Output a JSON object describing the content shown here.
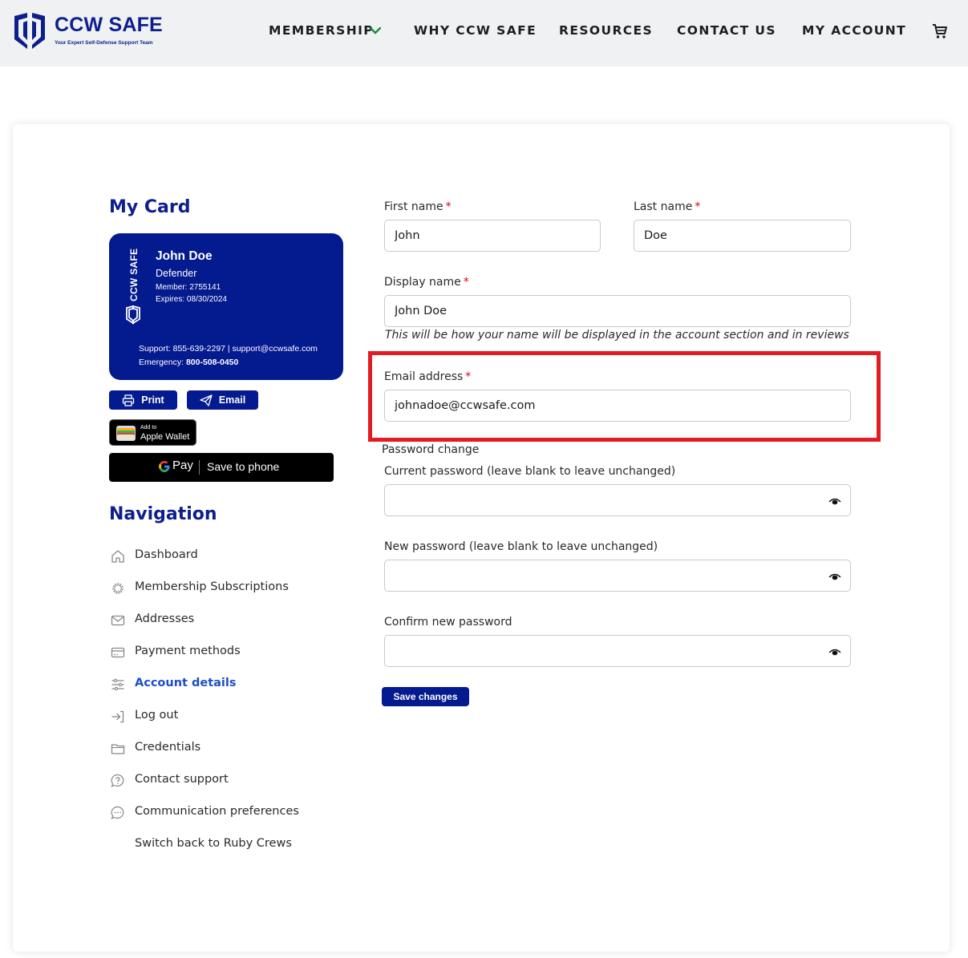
{
  "header": {
    "logo_text": "CCW SAFE",
    "logo_tagline": "Your Expert Self-Defense Support Team",
    "nav": {
      "membership": "MEMBERSHIP",
      "why": "WHY CCW SAFE",
      "resources": "RESOURCES",
      "contact": "CONTACT US",
      "account": "MY ACCOUNT"
    }
  },
  "sidebar": {
    "my_card_title": "My Card",
    "card": {
      "brand": "CCW SAFE",
      "name": "John Doe",
      "level": "Defender",
      "member": "Member: 2755141",
      "expires": "Expires: 08/30/2024",
      "support": "Support: 855-639-2297 | support@ccwsafe.com",
      "emergency_label": "Emergency:",
      "emergency_number": "800-508-0450"
    },
    "print_label": "Print",
    "email_label": "Email",
    "wallet_small": "Add to",
    "wallet_big": "Apple Wallet",
    "gpay_pay": "Pay",
    "gpay_text": "Save to phone",
    "navigation_title": "Navigation",
    "items": [
      {
        "label": "Dashboard"
      },
      {
        "label": "Membership Subscriptions"
      },
      {
        "label": "Addresses"
      },
      {
        "label": "Payment methods"
      },
      {
        "label": "Account details",
        "active": true
      },
      {
        "label": "Log out"
      },
      {
        "label": "Credentials"
      },
      {
        "label": "Contact support"
      },
      {
        "label": "Communication preferences"
      },
      {
        "label": "Switch back to Ruby Crews"
      }
    ]
  },
  "form": {
    "first_name_label": "First name",
    "first_name_value": "John",
    "last_name_label": "Last name",
    "last_name_value": "Doe",
    "display_name_label": "Display name",
    "display_name_value": "John Doe",
    "display_name_hint": "This will be how your name will be displayed in the account section and in reviews",
    "email_label": "Email address",
    "email_value": "johnadoe@ccwsafe.com",
    "password_change_label": "Password change",
    "current_password_label": "Current password (leave blank to leave unchanged)",
    "new_password_label": "New password (leave blank to leave unchanged)",
    "confirm_password_label": "Confirm new password",
    "required_mark": "*",
    "save_label": "Save changes"
  },
  "colors": {
    "brand": "#041a8f",
    "highlight": "#e31b23",
    "active_link": "#1c4fc7",
    "required": "#d9001b"
  }
}
